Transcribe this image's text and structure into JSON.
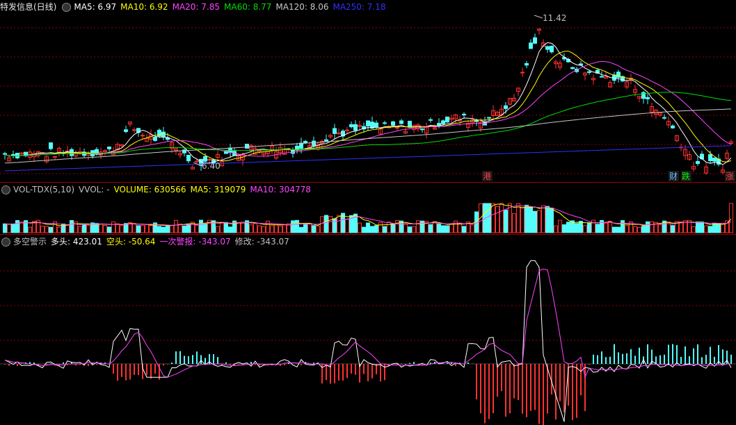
{
  "price_panel": {
    "title": "特发信息(日线)",
    "indicators": [
      {
        "label": "MA5: 6.97",
        "color": "#ffffff"
      },
      {
        "label": "MA10: 6.92",
        "color": "#ffff00"
      },
      {
        "label": "MA20: 7.85",
        "color": "#ff44ff"
      },
      {
        "label": "MA60: 8.77",
        "color": "#00dd00"
      },
      {
        "label": "MA120: 8.06",
        "color": "#c8c8c8"
      },
      {
        "label": "MA250: 7.18",
        "color": "#3030ff"
      }
    ],
    "high_label": "11.42",
    "low_label": "6.40",
    "events": [
      {
        "text": "港",
        "color": "#ff4040"
      },
      {
        "text": "财",
        "color": "#60c0ff"
      },
      {
        "text": "跌",
        "color": "#00ff00"
      },
      {
        "text": "涨",
        "color": "#ff4040"
      }
    ]
  },
  "volume_panel": {
    "title": "VOL-TDX(5,10)",
    "indicators": [
      {
        "label": "VVOL: -",
        "color": "#c0c0c0"
      },
      {
        "label": "VOLUME: 630566",
        "color": "#ffff00"
      },
      {
        "label": "MA5: 319079",
        "color": "#ffff00"
      },
      {
        "label": "MA10: 304778",
        "color": "#ff44ff"
      }
    ]
  },
  "indicator_panel": {
    "title": "多空警示",
    "indicators": [
      {
        "label": "多头: 423.01",
        "color": "#ffffff"
      },
      {
        "label": "空头: -50.64",
        "color": "#ffff00"
      },
      {
        "label": "一次警报: -343.07",
        "color": "#ff44ff"
      },
      {
        "label": "修改: -343.07",
        "color": "#c0c0c0"
      }
    ]
  },
  "chart_data": [
    {
      "type": "line",
      "series": [
        {
          "name": "MA5",
          "values": [
            6.97
          ]
        },
        {
          "name": "MA10",
          "values": [
            6.92
          ]
        },
        {
          "name": "MA20",
          "values": [
            7.85
          ]
        },
        {
          "name": "MA60",
          "values": [
            8.77
          ]
        },
        {
          "name": "MA120",
          "values": [
            8.06
          ]
        },
        {
          "name": "MA250",
          "values": [
            7.18
          ]
        }
      ],
      "annotations": [
        {
          "text": "11.42"
        },
        {
          "text": "6.40"
        }
      ]
    },
    {
      "type": "bar",
      "series": [
        {
          "name": "VOLUME",
          "values": [
            630566
          ]
        },
        {
          "name": "MA5",
          "values": [
            319079
          ]
        },
        {
          "name": "MA10",
          "values": [
            304778
          ]
        }
      ]
    },
    {
      "type": "line",
      "series": [
        {
          "name": "多头",
          "values": [
            423.01
          ]
        },
        {
          "name": "空头",
          "values": [
            -50.64
          ]
        },
        {
          "name": "一次警报",
          "values": [
            -343.07
          ]
        },
        {
          "name": "修改",
          "values": [
            -343.07
          ]
        }
      ]
    }
  ],
  "colors": {
    "up": "#ff3232",
    "down": "#54fcfc",
    "grid": "#8b0000"
  }
}
